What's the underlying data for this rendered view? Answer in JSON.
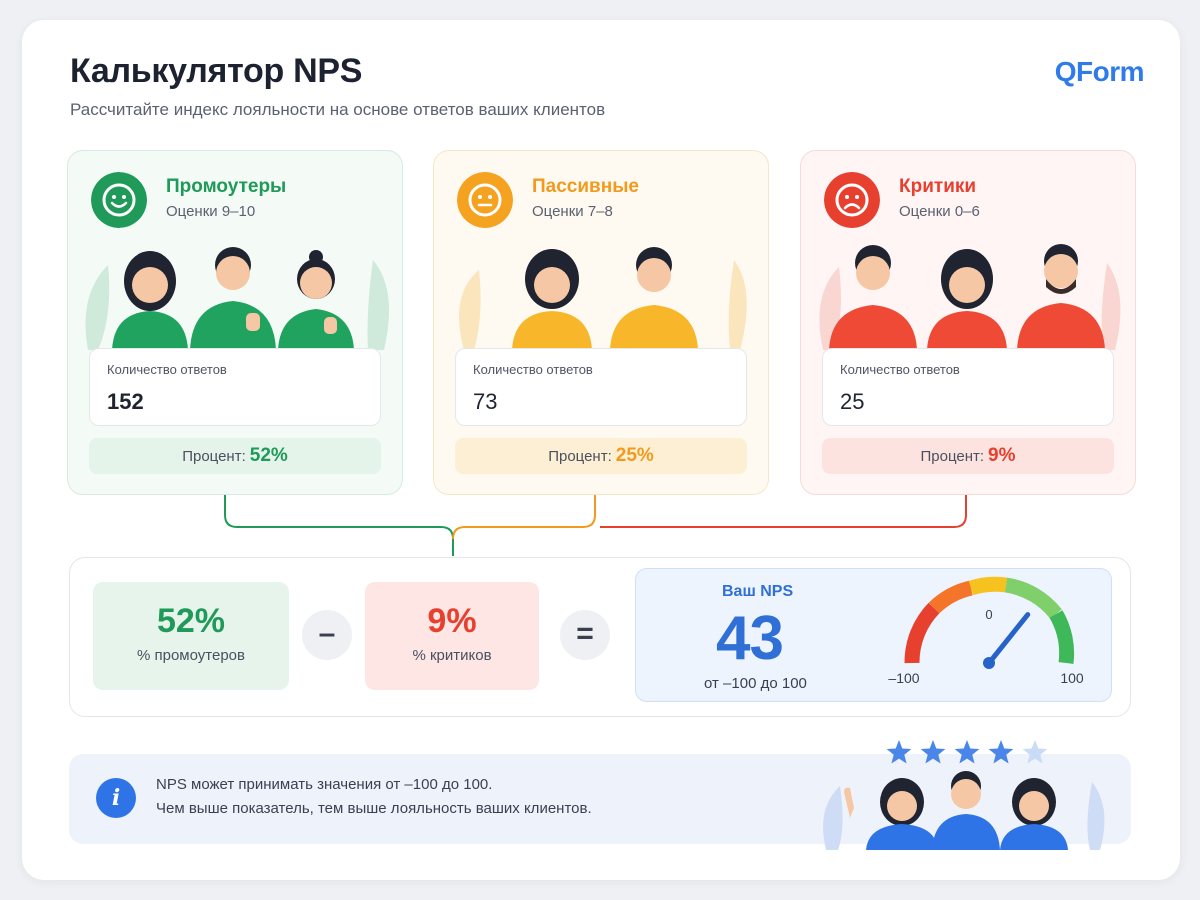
{
  "header": {
    "title": "Калькулятор NPS",
    "subtitle": "Рассчитайте индекс лояльности на основе ответов ваших клиентов",
    "logo": "QForm"
  },
  "segments": [
    {
      "name": "Промоутеры",
      "range": "Оценки 9–10",
      "count_label": "Количество ответов",
      "count": "152",
      "percent_label": "Процент:",
      "percent": "52%",
      "color": "#1f9a58",
      "icon": "smile-face-icon"
    },
    {
      "name": "Пассивные",
      "range": "Оценки 7–8",
      "count_label": "Количество ответов",
      "count": "73",
      "percent_label": "Процент:",
      "percent": "25%",
      "color": "#f29a1d",
      "icon": "neutral-face-icon"
    },
    {
      "name": "Критики",
      "range": "Оценки 0–6",
      "count_label": "Количество ответов",
      "count": "25",
      "percent_label": "Процент:",
      "percent": "9%",
      "color": "#e8402f",
      "icon": "sad-face-icon"
    }
  ],
  "formula": {
    "promoters_value": "52%",
    "promoters_label": "% промоутеров",
    "minus": "–",
    "critics_value": "9%",
    "critics_label": "% критиков",
    "equals": "=",
    "result_label": "Ваш NPS",
    "result_value": "43",
    "result_range": "от –100 до 100",
    "gauge": {
      "min_label": "–100",
      "mid_label": "0",
      "max_label": "100",
      "value": 43
    }
  },
  "info": {
    "icon": "info-icon",
    "line1": "NPS может принимать значения от –100 до 100.",
    "line2": "Чем выше показатель, тем выше лояльность ваших клиентов.",
    "stars_filled": 4,
    "stars_total": 5
  },
  "colors": {
    "accent": "#2f74e6",
    "promoter": "#1f9a58",
    "passive": "#f29a1d",
    "critic": "#e8402f"
  }
}
